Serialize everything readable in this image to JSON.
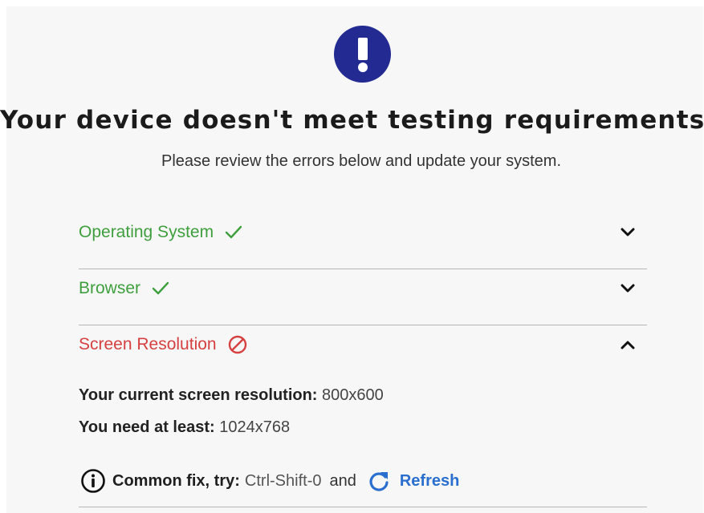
{
  "header": {
    "alert_icon": "exclamation-circle-icon",
    "title": "Your device doesn't meet testing requirements",
    "subtitle": "Please review the errors below and update your system."
  },
  "checks": [
    {
      "label": "Operating System",
      "status": "pass",
      "status_icon": "checkmark-icon",
      "expanded": false
    },
    {
      "label": "Browser",
      "status": "pass",
      "status_icon": "checkmark-icon",
      "expanded": false
    },
    {
      "label": "Screen Resolution",
      "status": "fail",
      "status_icon": "prohibited-icon",
      "expanded": true
    }
  ],
  "resolution_details": {
    "current_label": "Your current screen resolution:",
    "current_value": "800x600",
    "required_label": "You need at least:",
    "required_value": "1024x768"
  },
  "fix": {
    "info_icon": "info-icon",
    "label": "Common fix, try:",
    "shortcut": "Ctrl-Shift-0",
    "and_text": "and",
    "refresh_label": "Refresh",
    "refresh_icon": "refresh-icon"
  },
  "colors": {
    "accent": "#232a92",
    "pass": "#3f9f3f",
    "fail": "#d64040",
    "link": "#2a6fcf"
  }
}
